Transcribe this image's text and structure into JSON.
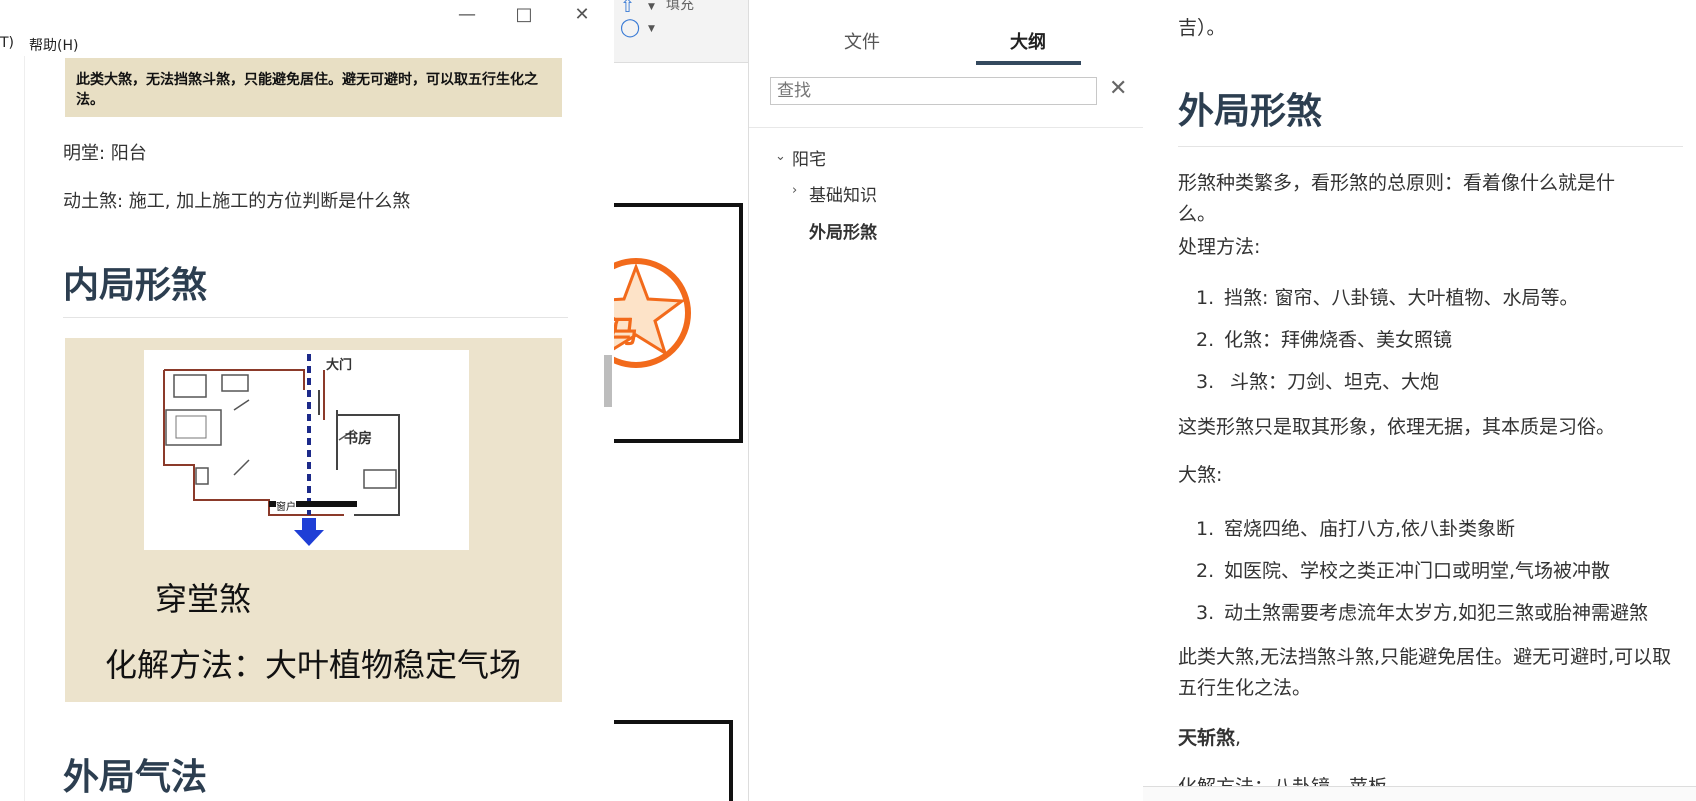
{
  "left_window": {
    "menu_left_fragment": "T)",
    "menu_help": "帮助(H)",
    "quote": "此类大煞，无法挡煞斗煞，只能避免居住。避无可避时，可以取五行生化之法。",
    "line_mingtang": "明堂: 阳台",
    "line_dongtu": "动土煞: 施工, 加上施工的方位判断是什么煞",
    "heading_neiju": "内局形煞",
    "image_door_label": "大门",
    "image_study_label": "书房",
    "image_window_label": "窗户",
    "image_caption_1": "穿堂煞",
    "image_caption_2": "化解方法：大叶植物稳定气场",
    "heading_waiju_qifa": "外局气法"
  },
  "mid_background": {
    "fill_label": "填充",
    "stamp_char": "马"
  },
  "sidebar": {
    "tabs": [
      {
        "label": "文件",
        "active": false
      },
      {
        "label": "大纲",
        "active": true
      }
    ],
    "search_placeholder": "查找",
    "outline": [
      {
        "label": "阳宅",
        "level": 0,
        "expanded": true
      },
      {
        "label": "基础知识",
        "level": 1,
        "expanded": false
      },
      {
        "label": "外局形煞",
        "level": 1,
        "current": true
      }
    ]
  },
  "doc": {
    "top_fragment": "吉）。",
    "heading": "外局形煞",
    "para1": "形煞种类繁多，看形煞的总原则：看着像什么就是什么。",
    "para_method": "处理方法:",
    "list1": [
      {
        "num": "1.",
        "text": "挡煞:  窗帘、八卦镜、大叶植物、水局等。"
      },
      {
        "num": "2.",
        "text": "化煞：拜佛烧香、美女照镜"
      },
      {
        "num": "3.",
        "text": " 斗煞：刀剑、坦克、大炮"
      }
    ],
    "para2": "这类形煞只是取其形象，依理无据，其本质是习俗。",
    "para_dasha": "大煞:",
    "list2": [
      {
        "num": "1.",
        "text": "窑烧四绝、庙打八方,依八卦类象断"
      },
      {
        "num": "2.",
        "text": "如医院、学校之类正冲门口或明堂,气场被冲散"
      },
      {
        "num": "3.",
        "text": "动土煞需要考虑流年太岁方,如犯三煞或胎神需避煞"
      }
    ],
    "para3": "此类大煞,无法挡煞斗煞,只能避免居住。避无可避时,可以取五行生化之法。",
    "tianzhan_bold": "天斩煞",
    "tianzhan_suffix": ",",
    "partial_bottom": "化解方法：八卦镜、苹板"
  },
  "colors": {
    "heading": "#2c3e50",
    "quote_bg": "#e8dfc4",
    "tab_underline": "#34495e"
  }
}
